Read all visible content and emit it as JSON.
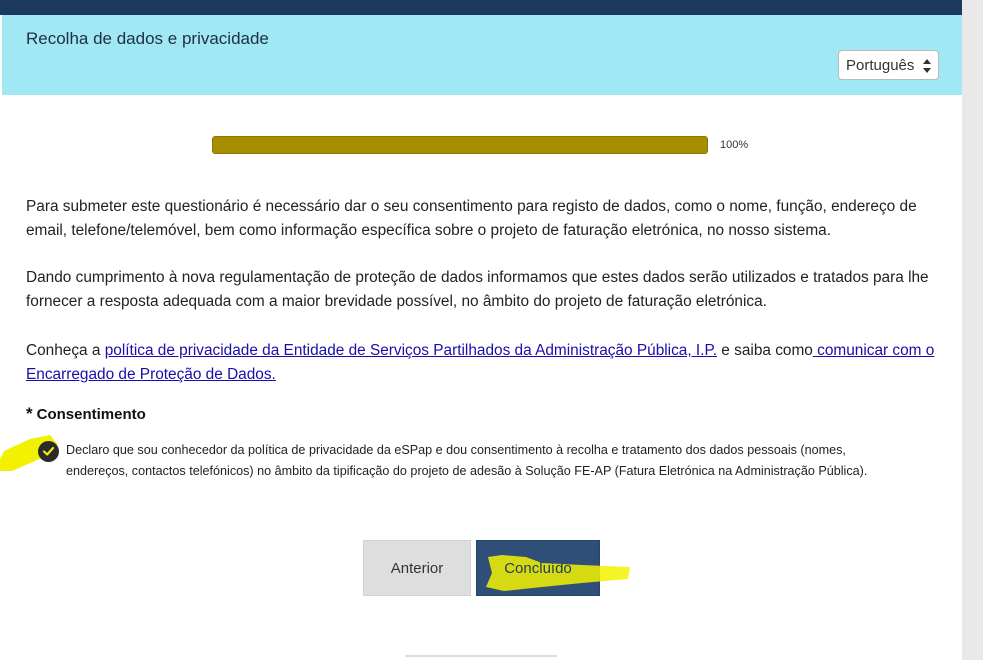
{
  "header": {
    "title": "Recolha de dados e privacidade",
    "language": "Português"
  },
  "progress": {
    "value_percent": 100,
    "label": "100%",
    "color": "#a78e00"
  },
  "content": {
    "paragraph1": "Para submeter este questionário é necessário dar o seu consentimento para registo de dados, como o nome, função, endereço de email, telefone/telemóvel, bem como informação específica sobre o projeto de faturação eletrónica, no nosso sistema.",
    "paragraph2": "Dando cumprimento à nova regulamentação de proteção de dados informamos que estes dados serão utilizados e tratados para lhe fornecer a resposta adequada com a maior brevidade possível, no âmbito do projeto de faturação eletrónica.",
    "paragraph3": {
      "prefix": "Conheça a ",
      "link1": "política de privacidade da Entidade de Serviços Partilhados da Administração Pública, I.P.",
      "middle": " e saiba como",
      "link2": " comunicar com o Encarregado de Proteção de Dados."
    }
  },
  "consent": {
    "required_mark": "*",
    "title": "Consentimento",
    "checked": true,
    "text": "Declaro que sou conhecedor da política de privacidade da eSPap e dou consentimento à recolha e tratamento dos dados pessoais (nomes, endereços, contactos telefónicos) no âmbito da tipificação do projeto de adesão à Solução FE-AP (Fatura Eletrónica na Administração Pública)."
  },
  "buttons": {
    "previous": "Anterior",
    "done": "Concluído"
  },
  "colors": {
    "header_bg": "#a0e8f3",
    "topbar": "#1b3a5e",
    "done_button_bg": "#2f4f78",
    "highlight": "#f2f200"
  }
}
